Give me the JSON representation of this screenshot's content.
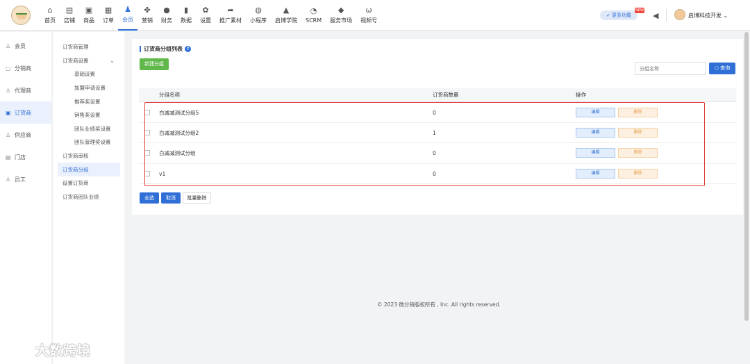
{
  "topnav": {
    "items": [
      {
        "label": "首页",
        "icon": "home-icon",
        "glyph": "⌂"
      },
      {
        "label": "店铺",
        "icon": "store-icon",
        "glyph": "▤"
      },
      {
        "label": "商品",
        "icon": "goods-icon",
        "glyph": "▣"
      },
      {
        "label": "订单",
        "icon": "order-icon",
        "glyph": "▦"
      },
      {
        "label": "会员",
        "icon": "member-icon",
        "glyph": "♟",
        "active": true
      },
      {
        "label": "营销",
        "icon": "marketing-icon",
        "glyph": "✤"
      },
      {
        "label": "财务",
        "icon": "finance-icon",
        "glyph": "●"
      },
      {
        "label": "数据",
        "icon": "data-icon",
        "glyph": "▮"
      },
      {
        "label": "设置",
        "icon": "settings-icon",
        "glyph": "✿"
      },
      {
        "label": "推广素材",
        "icon": "share-icon",
        "glyph": "➦"
      },
      {
        "label": "小程序",
        "icon": "miniapp-icon",
        "glyph": "◍"
      },
      {
        "label": "启博学院",
        "icon": "academy-icon",
        "glyph": "▲"
      },
      {
        "label": "SCRM",
        "icon": "scrm-icon",
        "glyph": "◔"
      },
      {
        "label": "服务市场",
        "icon": "market-icon",
        "glyph": "◆"
      },
      {
        "label": "视频号",
        "icon": "video-icon",
        "glyph": "ω"
      }
    ],
    "more_label": "更多功能",
    "new_badge": "NEW",
    "user_label": "启博科技开发"
  },
  "sidebar1": {
    "items": [
      {
        "label": "会员",
        "icon": "member-icon",
        "glyph": "♙"
      },
      {
        "label": "分销商",
        "icon": "distributor-icon",
        "glyph": "▢"
      },
      {
        "label": "代理商",
        "icon": "agent-icon",
        "glyph": "♙"
      },
      {
        "label": "订货商",
        "icon": "orderer-icon",
        "glyph": "▣",
        "active": true
      },
      {
        "label": "供应商",
        "icon": "supplier-icon",
        "glyph": "♙"
      },
      {
        "label": "门店",
        "icon": "shop-icon",
        "glyph": "▤"
      },
      {
        "label": "员工",
        "icon": "staff-icon",
        "glyph": "♙"
      }
    ]
  },
  "sidebar2": {
    "items": [
      {
        "label": "订货商管理",
        "sub": false
      },
      {
        "label": "订货商设置",
        "sub": false,
        "chevron": "⌄"
      },
      {
        "label": "基础设置",
        "sub": true
      },
      {
        "label": "加盟申请设置",
        "sub": true
      },
      {
        "label": "推荐奖设置",
        "sub": true
      },
      {
        "label": "销售奖设置",
        "sub": true
      },
      {
        "label": "团队业绩奖设置",
        "sub": true
      },
      {
        "label": "团队管理奖设置",
        "sub": true
      },
      {
        "label": "订货商审核",
        "sub": false
      },
      {
        "label": "订货商分组",
        "sub": false,
        "active": true
      },
      {
        "label": "设置订货商",
        "sub": false
      },
      {
        "label": "订货商团队业绩",
        "sub": false
      }
    ]
  },
  "main": {
    "title": "订货商分组列表",
    "help_glyph": "?",
    "new_button": "新建分组",
    "search_placeholder": "分组名称",
    "search_button": "查询",
    "columns": {
      "name": "分组名称",
      "count": "订货商数量",
      "actions": "操作"
    },
    "rows": [
      {
        "name": "白减减测试分组5",
        "count": "0"
      },
      {
        "name": "白减减测试分组2",
        "count": "1"
      },
      {
        "name": "白减减测试分组",
        "count": "0"
      },
      {
        "name": "v1",
        "count": "0"
      }
    ],
    "edit_label": "编辑",
    "delete_label": "删除",
    "select_all": "全选",
    "cancel": "取消",
    "batch_delete": "批量删除"
  },
  "footer": {
    "copyright": "© 2023 微分销版权所有 , Inc. All rights reserved."
  },
  "watermark": {
    "text": "大数跨境"
  },
  "colors": {
    "primary": "#2f6fd6",
    "green": "#61b84a",
    "highlight_box": "#e23b3b"
  }
}
